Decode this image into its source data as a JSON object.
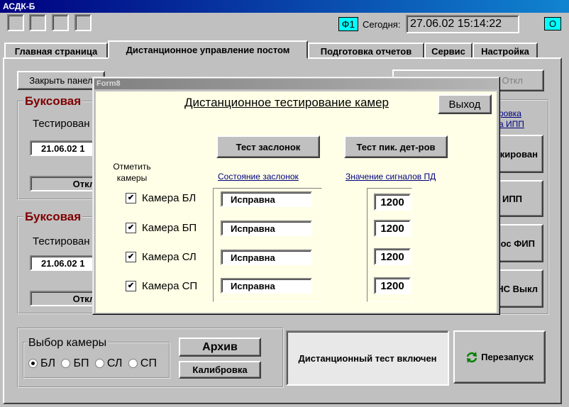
{
  "window": {
    "title": "АСДК-Б"
  },
  "header": {
    "f1_label": "Ф1",
    "today_label": "Сегодня:",
    "datetime": "27.06.02 15:14:22",
    "o_label": "О"
  },
  "tabs": [
    {
      "label": "Главная страница"
    },
    {
      "label": "Дистанционное управление постом"
    },
    {
      "label": "Подготовка отчетов"
    },
    {
      "label": "Сервис"
    },
    {
      "label": "Настройка"
    }
  ],
  "background": {
    "close_panel_button": "Закрыть панел",
    "off_button_top": "Откл",
    "group1_title": "Буксовая",
    "group1_testing_label": "Тестирован",
    "group1_date": "21.06.02  1",
    "group1_off": "Откл",
    "group2_title": "Буксовая",
    "group2_testing_label": "Тестирован",
    "group2_date": "21.06.02  1",
    "group2_off": "Откл",
    "right_link_line1": "ровка",
    "right_link_line2": "а ИПП",
    "right_buttons": [
      "кирован",
      "ИПП",
      "ос ФИП",
      "НС Выкл"
    ]
  },
  "camera_select": {
    "title": "Выбор камеры",
    "options": [
      "БЛ",
      "БП",
      "СЛ",
      "СП"
    ],
    "selected": "БЛ"
  },
  "archive_button": "Архив",
  "calibration_button": "Калибровка",
  "remote_test_status": "Дистанционный тест включен",
  "restart_button": "Перезапуск",
  "dialog": {
    "title": "Form8",
    "heading": "Дистанционное тестирование камер",
    "exit_button": "Выход",
    "test_dampers_button": "Тест  заслонок",
    "test_detectors_button": "Тест пик. дет-ров",
    "mark_cameras_line1": "Отметить",
    "mark_cameras_line2": "камеры",
    "damper_state_label": "Состояние заслонок",
    "signal_values_label": "Значение сигналов ПД",
    "cameras": [
      {
        "label": "Камера БЛ",
        "checked": true,
        "state": "Исправна",
        "value": "1200"
      },
      {
        "label": "Камера БП",
        "checked": true,
        "state": "Исправна",
        "value": "1200"
      },
      {
        "label": "Камера СЛ",
        "checked": true,
        "state": "Исправна",
        "value": "1200"
      },
      {
        "label": "Камера СП",
        "checked": true,
        "state": "Исправна",
        "value": "1200"
      }
    ]
  }
}
